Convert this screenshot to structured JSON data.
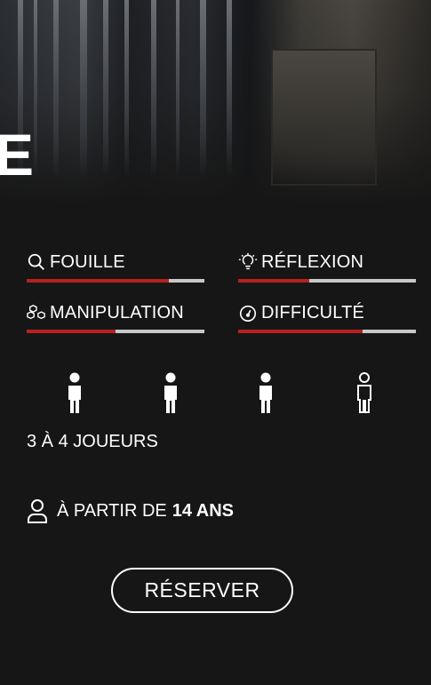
{
  "hero": {
    "letter": "E"
  },
  "stats": [
    {
      "label": "FOUILLE",
      "icon": "search-icon",
      "level": 0.8,
      "color": "#b7201f"
    },
    {
      "label": "RÉFLEXION",
      "icon": "lightbulb-icon",
      "level": 0.4,
      "color": "#b7201f"
    },
    {
      "label": "MANIPULATION",
      "icon": "cubes-icon",
      "level": 0.5,
      "color": "#b7201f"
    },
    {
      "label": "DIFFICULTÉ",
      "icon": "gauge-icon",
      "level": 0.7,
      "color": "#b7201f"
    }
  ],
  "players": {
    "text": "3 À 4 JOUEURS",
    "filled": 3,
    "total": 4
  },
  "age": {
    "prefix": "À PARTIR DE",
    "value": "14 ANS"
  },
  "reserve_label": "RÉSERVER"
}
